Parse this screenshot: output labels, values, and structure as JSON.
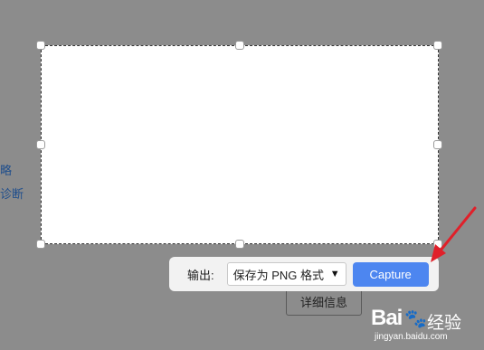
{
  "background": {
    "link_1": "略",
    "link_2": "诊断",
    "details_button": "详细信息"
  },
  "toolbar": {
    "output_label": "输出:",
    "format_selected": "保存为 PNG 格式",
    "capture_label": "Capture"
  },
  "watermark": {
    "logo": "Bai",
    "logo_icon": "paw-icon",
    "text": "经验",
    "url": "jingyan.baidu.com"
  },
  "colors": {
    "overlay": "#8c8c8c",
    "capture_button": "#4d86f0",
    "arrow": "#e0202a"
  }
}
